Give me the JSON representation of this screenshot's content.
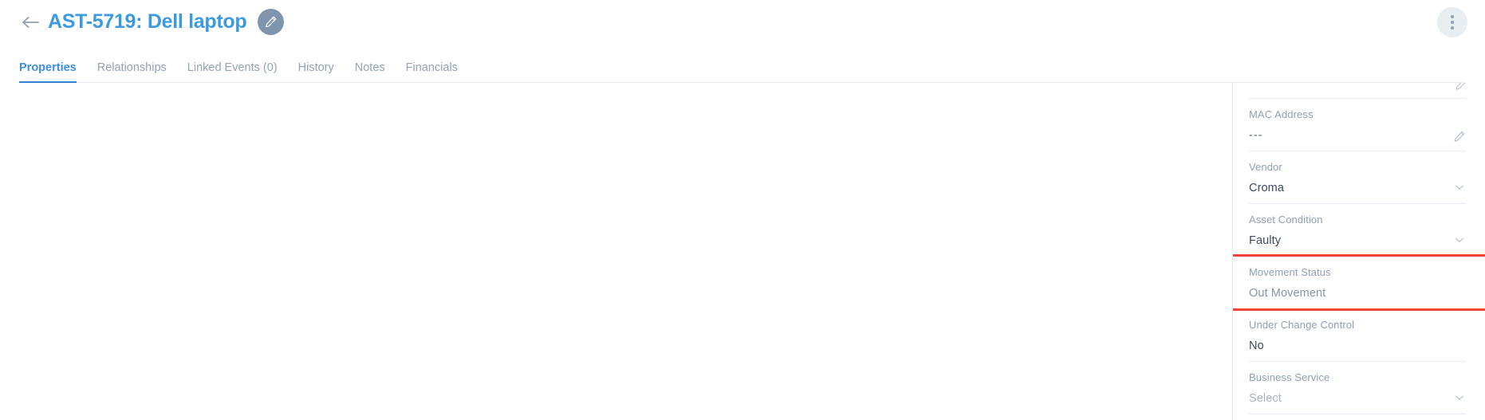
{
  "header": {
    "back_icon": "arrow-left-icon",
    "title": "AST-5719: Dell laptop",
    "edit_badge_icon": "pencil-icon",
    "kebab_icon": "more-vertical-icon"
  },
  "tabs": [
    {
      "label": "Properties",
      "active": true
    },
    {
      "label": "Relationships",
      "active": false
    },
    {
      "label": "Linked Events (0)",
      "active": false
    },
    {
      "label": "History",
      "active": false
    },
    {
      "label": "Notes",
      "active": false
    },
    {
      "label": "Financials",
      "active": false
    }
  ],
  "properties_panel": {
    "fields": [
      {
        "label": "",
        "value": "",
        "icon": "pencil-icon",
        "clipped": true,
        "value_style": "muted"
      },
      {
        "label": "MAC Address",
        "value": "---",
        "icon": "pencil-icon",
        "value_style": "dashes"
      },
      {
        "label": "Vendor",
        "value": "Croma",
        "icon": "chevron-down-icon",
        "value_style": "normal"
      },
      {
        "label": "Asset Condition",
        "value": "Faulty",
        "icon": "chevron-down-icon",
        "value_style": "normal"
      },
      {
        "label": "Movement Status",
        "value": "Out Movement",
        "icon": "",
        "value_style": "muted",
        "highlighted": true
      },
      {
        "label": "Under Change Control",
        "value": "No",
        "icon": "",
        "value_style": "normal"
      },
      {
        "label": "Business Service",
        "value": "Select",
        "icon": "chevron-down-icon",
        "value_style": "placeholder"
      }
    ]
  },
  "colors": {
    "title_blue": "#3d9ae0",
    "active_tab_blue": "#3f8ddd",
    "label_gray": "#8fa0b6",
    "value_slate": "#3d4b5c",
    "highlight_red": "#f5443c",
    "edit_badge_bg": "#7e95ad"
  }
}
